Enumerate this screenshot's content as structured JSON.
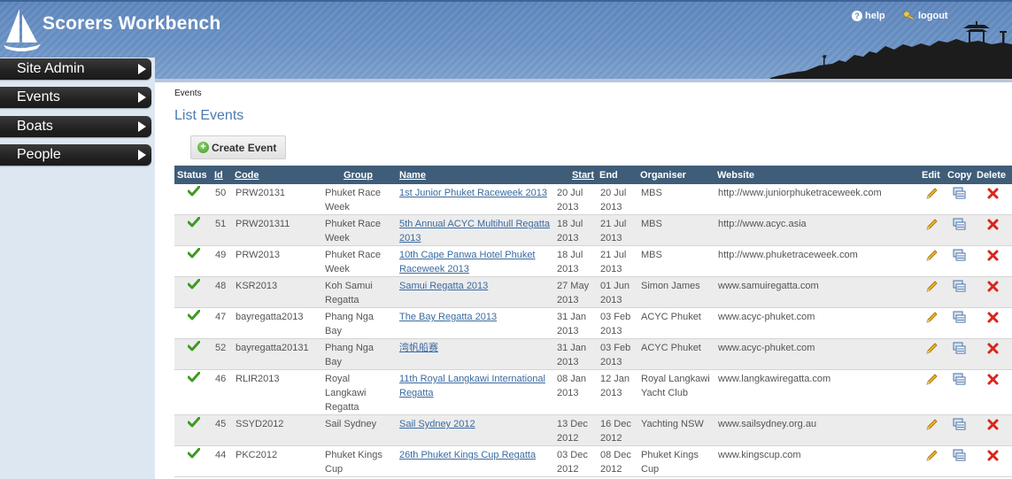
{
  "header": {
    "app_title": "Scorers Workbench",
    "help_label": "help",
    "logout_label": "logout",
    "logo_icon": "sailboat-logo-icon"
  },
  "sidebar": {
    "items": [
      {
        "label": "Site Admin"
      },
      {
        "label": "Events"
      },
      {
        "label": "Boats"
      },
      {
        "label": "People"
      }
    ]
  },
  "breadcrumb": "Events",
  "page_title": "List Events",
  "create_button_label": "Create Event",
  "table": {
    "columns": [
      "Status",
      "Id",
      "Code",
      "Group",
      "Name",
      "Start",
      "End",
      "Organiser",
      "Website",
      "Edit",
      "Copy",
      "Delete"
    ],
    "rows": [
      {
        "id": "50",
        "code": "PRW20131",
        "group": "Phuket Race Week",
        "name": "1st Junior Phuket Raceweek 2013",
        "start": "20 Jul 2013",
        "end": "20 Jul 2013",
        "organiser": "MBS",
        "website": "http://www.juniorphuketraceweek.com"
      },
      {
        "id": "51",
        "code": "PRW201311",
        "group": "Phuket Race Week",
        "name": "5th Annual ACYC Multihull Regatta 2013",
        "start": "18 Jul 2013",
        "end": "21 Jul 2013",
        "organiser": "MBS",
        "website": "http://www.acyc.asia"
      },
      {
        "id": "49",
        "code": "PRW2013",
        "group": "Phuket Race Week",
        "name": "10th Cape Panwa Hotel Phuket Raceweek 2013",
        "start": "18 Jul 2013",
        "end": "21 Jul 2013",
        "organiser": "MBS",
        "website": "http://www.phuketraceweek.com"
      },
      {
        "id": "48",
        "code": "KSR2013",
        "group": "Koh Samui Regatta",
        "name": "Samui Regatta 2013",
        "start": "27 May 2013",
        "end": "01 Jun 2013",
        "organiser": "Simon James",
        "website": "www.samuiregatta.com"
      },
      {
        "id": "47",
        "code": "bayregatta2013",
        "group": "Phang Nga Bay",
        "name": "The Bay Regatta 2013",
        "start": "31 Jan 2013",
        "end": "03 Feb 2013",
        "organiser": "ACYC Phuket",
        "website": "www.acyc-phuket.com"
      },
      {
        "id": "52",
        "code": "bayregatta20131",
        "group": "Phang Nga Bay",
        "name": "湾帆船赛",
        "start": "31 Jan 2013",
        "end": "03 Feb 2013",
        "organiser": "ACYC Phuket",
        "website": "www.acyc-phuket.com"
      },
      {
        "id": "46",
        "code": "RLIR2013",
        "group": "Royal Langkawi Regatta",
        "name": "11th Royal Langkawi International Regatta",
        "start": "08 Jan 2013",
        "end": "12 Jan 2013",
        "organiser": "Royal Langkawi Yacht Club",
        "website": "www.langkawiregatta.com"
      },
      {
        "id": "45",
        "code": "SSYD2012",
        "group": "Sail Sydney",
        "name": "Sail Sydney 2012",
        "start": "13 Dec 2012",
        "end": "16 Dec 2012",
        "organiser": "Yachting NSW",
        "website": "www.sailsydney.org.au"
      },
      {
        "id": "44",
        "code": "PKC2012",
        "group": "Phuket Kings Cup",
        "name": "26th Phuket Kings Cup Regatta",
        "start": "03 Dec 2012",
        "end": "08 Dec 2012",
        "organiser": "Phuket Kings Cup",
        "website": "www.kingscup.com"
      }
    ]
  },
  "colors": {
    "header_blue": "#6b93c6",
    "table_header": "#3f5d78",
    "link_blue": "#3a6aa0",
    "title_blue": "#4a7ab1",
    "status_green": "#3f9a24",
    "delete_red": "#d9261c"
  }
}
